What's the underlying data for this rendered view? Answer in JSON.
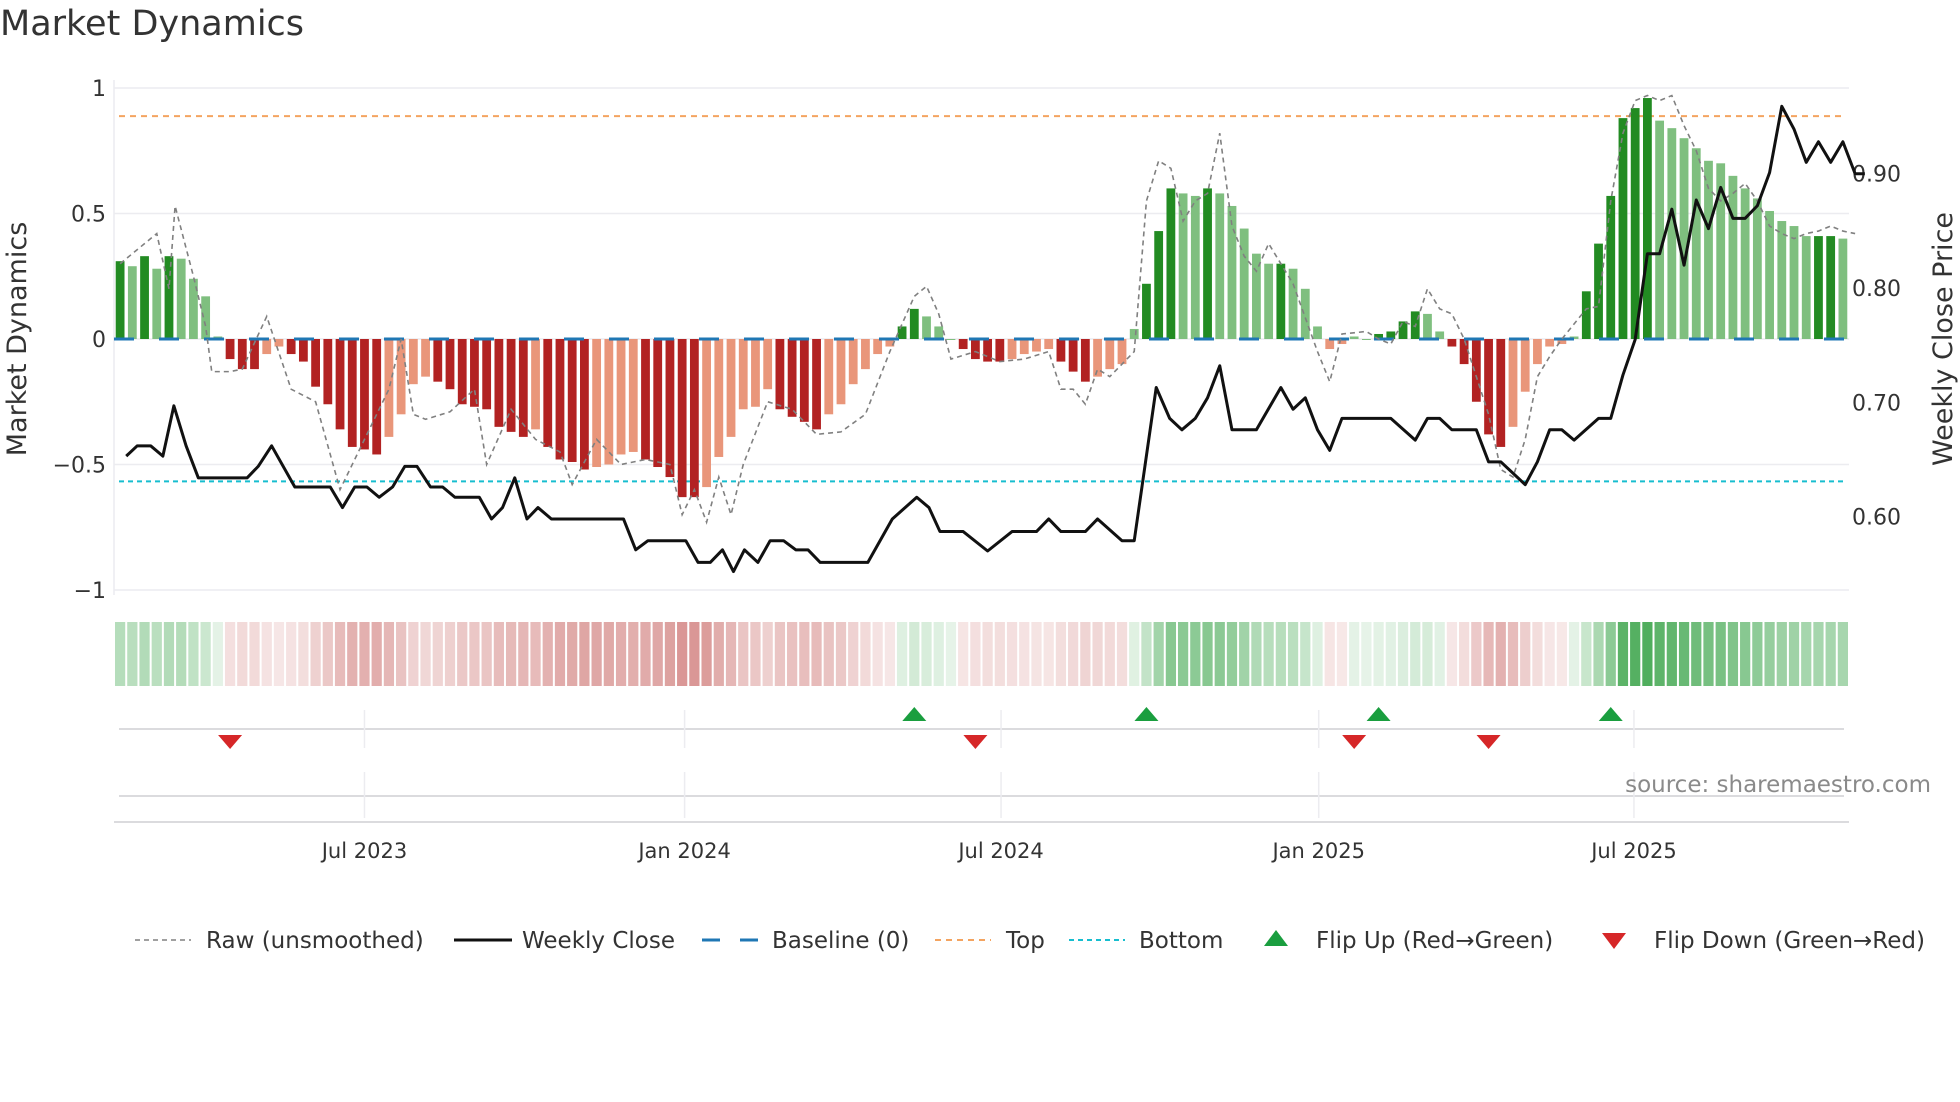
{
  "chart_data": {
    "type": "bar",
    "title": "Market Dynamics",
    "ylabel": "Market Dynamics",
    "y2label": "Weekly Close Price",
    "ylim": [
      -1,
      1
    ],
    "y2lim": [
      0.535,
      0.975
    ],
    "yticks": [
      {
        "v": 1,
        "label": "1"
      },
      {
        "v": 0.5,
        "label": "0.5"
      },
      {
        "v": 0,
        "label": "0"
      },
      {
        "v": -0.5,
        "label": "−0.5"
      },
      {
        "v": -1,
        "label": "−1"
      }
    ],
    "y2ticks": [
      {
        "v": 0.9,
        "label": "0.90"
      },
      {
        "v": 0.8,
        "label": "0.80"
      },
      {
        "v": 0.7,
        "label": "0.70"
      },
      {
        "v": 0.6,
        "label": "0.60"
      }
    ],
    "xticks": [
      {
        "week": 20,
        "label": "Jul 2023"
      },
      {
        "week": 46.2,
        "label": "Jan 2024"
      },
      {
        "week": 72.1,
        "label": "Jul 2024"
      },
      {
        "week": 98.1,
        "label": "Jan 2025"
      },
      {
        "week": 123.9,
        "label": "Jul 2025"
      }
    ],
    "x_unit": "weeks since start (Feb 2023)",
    "top_level": 0.888,
    "bottom_level": -0.567,
    "baseline": 0,
    "bars": [
      0.31,
      0.29,
      0.33,
      0.28,
      0.33,
      0.32,
      0.24,
      0.17,
      0.01,
      -0.08,
      -0.12,
      -0.12,
      -0.06,
      -0.03,
      -0.06,
      -0.09,
      -0.19,
      -0.26,
      -0.36,
      -0.43,
      -0.44,
      -0.46,
      -0.39,
      -0.3,
      -0.18,
      -0.15,
      -0.17,
      -0.2,
      -0.26,
      -0.27,
      -0.28,
      -0.35,
      -0.37,
      -0.39,
      -0.36,
      -0.43,
      -0.48,
      -0.49,
      -0.52,
      -0.51,
      -0.5,
      -0.46,
      -0.45,
      -0.48,
      -0.51,
      -0.55,
      -0.63,
      -0.63,
      -0.59,
      -0.47,
      -0.39,
      -0.28,
      -0.27,
      -0.2,
      -0.28,
      -0.31,
      -0.33,
      -0.36,
      -0.3,
      -0.26,
      -0.18,
      -0.12,
      -0.06,
      -0.03,
      0.05,
      0.12,
      0.09,
      0.05,
      0.0,
      -0.04,
      -0.08,
      -0.09,
      -0.09,
      -0.08,
      -0.06,
      -0.05,
      -0.04,
      -0.09,
      -0.13,
      -0.17,
      -0.15,
      -0.12,
      -0.1,
      0.04,
      0.22,
      0.43,
      0.6,
      0.58,
      0.57,
      0.6,
      0.58,
      0.53,
      0.44,
      0.34,
      0.3,
      0.3,
      0.28,
      0.2,
      0.05,
      -0.04,
      -0.02,
      0.01,
      0.0,
      0.02,
      0.03,
      0.07,
      0.11,
      0.1,
      0.03,
      -0.03,
      -0.1,
      -0.25,
      -0.38,
      -0.43,
      -0.35,
      -0.21,
      -0.1,
      -0.03,
      -0.02,
      0.01,
      0.19,
      0.38,
      0.57,
      0.88,
      0.92,
      0.96,
      0.87,
      0.84,
      0.8,
      0.76,
      0.71,
      0.7,
      0.65,
      0.6,
      0.56,
      0.51,
      0.47,
      0.45,
      0.41,
      0.41,
      0.41,
      0.4
    ],
    "raw": [
      [
        0,
        0.3
      ],
      [
        3,
        0.42
      ],
      [
        4,
        0.2
      ],
      [
        4.5,
        0.53
      ],
      [
        6,
        0.25
      ],
      [
        7,
        0.05
      ],
      [
        7.5,
        -0.13
      ],
      [
        9,
        -0.13
      ],
      [
        10,
        -0.12
      ],
      [
        12,
        0.09
      ],
      [
        14,
        -0.2
      ],
      [
        16,
        -0.25
      ],
      [
        18,
        -0.6
      ],
      [
        20,
        -0.4
      ],
      [
        22,
        -0.2
      ],
      [
        23,
        0
      ],
      [
        24,
        -0.3
      ],
      [
        25,
        -0.32
      ],
      [
        27,
        -0.29
      ],
      [
        29,
        -0.2
      ],
      [
        30,
        -0.5
      ],
      [
        32,
        -0.28
      ],
      [
        34,
        -0.4
      ],
      [
        36,
        -0.45
      ],
      [
        37,
        -0.58
      ],
      [
        39,
        -0.4
      ],
      [
        41,
        -0.5
      ],
      [
        43,
        -0.48
      ],
      [
        45,
        -0.5
      ],
      [
        46,
        -0.7
      ],
      [
        47,
        -0.6
      ],
      [
        48,
        -0.73
      ],
      [
        49,
        -0.55
      ],
      [
        50,
        -0.7
      ],
      [
        51,
        -0.5
      ],
      [
        53,
        -0.25
      ],
      [
        55,
        -0.28
      ],
      [
        57,
        -0.38
      ],
      [
        59,
        -0.37
      ],
      [
        61,
        -0.3
      ],
      [
        63,
        -0.05
      ],
      [
        65,
        0.17
      ],
      [
        66,
        0.21
      ],
      [
        67,
        0.1
      ],
      [
        68,
        -0.08
      ],
      [
        70,
        -0.05
      ],
      [
        72,
        -0.09
      ],
      [
        74,
        -0.08
      ],
      [
        76,
        -0.05
      ],
      [
        77,
        -0.2
      ],
      [
        78,
        -0.2
      ],
      [
        79,
        -0.26
      ],
      [
        80,
        -0.12
      ],
      [
        81,
        -0.15
      ],
      [
        83,
        -0.05
      ],
      [
        84,
        0.55
      ],
      [
        85,
        0.71
      ],
      [
        86,
        0.68
      ],
      [
        87,
        0.47
      ],
      [
        88,
        0.55
      ],
      [
        89,
        0.58
      ],
      [
        90,
        0.82
      ],
      [
        91,
        0.45
      ],
      [
        92,
        0.33
      ],
      [
        93,
        0.27
      ],
      [
        94,
        0.38
      ],
      [
        95,
        0.3
      ],
      [
        96,
        0.22
      ],
      [
        98,
        -0.05
      ],
      [
        99,
        -0.17
      ],
      [
        100,
        0.02
      ],
      [
        102,
        0.03
      ],
      [
        103,
        0.0
      ],
      [
        104,
        -0.02
      ],
      [
        105,
        0.07
      ],
      [
        106,
        0.05
      ],
      [
        107,
        0.2
      ],
      [
        108,
        0.12
      ],
      [
        109,
        0.1
      ],
      [
        110,
        0.0
      ],
      [
        111,
        -0.15
      ],
      [
        112,
        -0.3
      ],
      [
        113,
        -0.52
      ],
      [
        114,
        -0.55
      ],
      [
        115,
        -0.4
      ],
      [
        116,
        -0.15
      ],
      [
        117,
        -0.07
      ],
      [
        118,
        0.0
      ],
      [
        120,
        0.12
      ],
      [
        121,
        0.13
      ],
      [
        122,
        0.55
      ],
      [
        123,
        0.82
      ],
      [
        124,
        0.95
      ],
      [
        125,
        0.97
      ],
      [
        126,
        0.95
      ],
      [
        127,
        0.97
      ],
      [
        128,
        0.85
      ],
      [
        129,
        0.75
      ],
      [
        130,
        0.6
      ],
      [
        131,
        0.55
      ],
      [
        132,
        0.58
      ],
      [
        133,
        0.62
      ],
      [
        134,
        0.55
      ],
      [
        135,
        0.45
      ],
      [
        136,
        0.42
      ],
      [
        137,
        0.4
      ],
      [
        138,
        0.42
      ],
      [
        139,
        0.43
      ],
      [
        140,
        0.45
      ],
      [
        141,
        0.43
      ],
      [
        142,
        0.42
      ]
    ],
    "price": [
      [
        0.5,
        0.653
      ],
      [
        1.4,
        0.662
      ],
      [
        2.5,
        0.662
      ],
      [
        3.5,
        0.653
      ],
      [
        4.4,
        0.697
      ],
      [
        5.4,
        0.662
      ],
      [
        6.4,
        0.634
      ],
      [
        10.4,
        0.634
      ],
      [
        11.3,
        0.644
      ],
      [
        12.4,
        0.662
      ],
      [
        14.3,
        0.626
      ],
      [
        17.2,
        0.626
      ],
      [
        18.2,
        0.608
      ],
      [
        19.2,
        0.626
      ],
      [
        20.2,
        0.626
      ],
      [
        21.2,
        0.617
      ],
      [
        22.3,
        0.626
      ],
      [
        23.3,
        0.644
      ],
      [
        24.3,
        0.644
      ],
      [
        25.4,
        0.626
      ],
      [
        26.4,
        0.626
      ],
      [
        27.4,
        0.617
      ],
      [
        29.4,
        0.617
      ],
      [
        30.4,
        0.598
      ],
      [
        31.3,
        0.608
      ],
      [
        32.3,
        0.634
      ],
      [
        33.3,
        0.598
      ],
      [
        34.2,
        0.608
      ],
      [
        35.3,
        0.598
      ],
      [
        41.2,
        0.598
      ],
      [
        42.2,
        0.571
      ],
      [
        43.2,
        0.579
      ],
      [
        46.3,
        0.579
      ],
      [
        47.3,
        0.56
      ],
      [
        48.3,
        0.56
      ],
      [
        49.3,
        0.571
      ],
      [
        50.2,
        0.552
      ],
      [
        51.1,
        0.571
      ],
      [
        52.2,
        0.56
      ],
      [
        53.2,
        0.579
      ],
      [
        54.3,
        0.579
      ],
      [
        55.3,
        0.571
      ],
      [
        56.3,
        0.571
      ],
      [
        57.3,
        0.56
      ],
      [
        61.2,
        0.56
      ],
      [
        63.2,
        0.598
      ],
      [
        65.2,
        0.617
      ],
      [
        66.2,
        0.608
      ],
      [
        67.1,
        0.587
      ],
      [
        69,
        0.587
      ],
      [
        71,
        0.57
      ],
      [
        73,
        0.587
      ],
      [
        75,
        0.587
      ],
      [
        76,
        0.598
      ],
      [
        77,
        0.587
      ],
      [
        79,
        0.587
      ],
      [
        80,
        0.598
      ],
      [
        82,
        0.579
      ],
      [
        83,
        0.579
      ],
      [
        84.8,
        0.713
      ],
      [
        85.9,
        0.686
      ],
      [
        86.9,
        0.676
      ],
      [
        88,
        0.686
      ],
      [
        89,
        0.704
      ],
      [
        90,
        0.732
      ],
      [
        91,
        0.676
      ],
      [
        93,
        0.676
      ],
      [
        95,
        0.713
      ],
      [
        96,
        0.694
      ],
      [
        97,
        0.704
      ],
      [
        98,
        0.676
      ],
      [
        99,
        0.658
      ],
      [
        100,
        0.686
      ],
      [
        104,
        0.686
      ],
      [
        106,
        0.667
      ],
      [
        107,
        0.686
      ],
      [
        108,
        0.686
      ],
      [
        109,
        0.676
      ],
      [
        111,
        0.676
      ],
      [
        112,
        0.648
      ],
      [
        113,
        0.648
      ],
      [
        115,
        0.628
      ],
      [
        116,
        0.648
      ],
      [
        117,
        0.676
      ],
      [
        118,
        0.676
      ],
      [
        119,
        0.667
      ],
      [
        121,
        0.686
      ],
      [
        122,
        0.686
      ],
      [
        123,
        0.724
      ],
      [
        124,
        0.755
      ],
      [
        125,
        0.83
      ],
      [
        126,
        0.83
      ],
      [
        127,
        0.869
      ],
      [
        128,
        0.82
      ],
      [
        129,
        0.877
      ],
      [
        130,
        0.852
      ],
      [
        131,
        0.888
      ],
      [
        132,
        0.861
      ],
      [
        133,
        0.861
      ],
      [
        134,
        0.872
      ],
      [
        135,
        0.901
      ],
      [
        136,
        0.959
      ],
      [
        137,
        0.939
      ],
      [
        138,
        0.91
      ],
      [
        139,
        0.928
      ],
      [
        140,
        0.91
      ],
      [
        141,
        0.928
      ],
      [
        142,
        0.9
      ],
      [
        142.8,
        0.9
      ]
    ],
    "flip_up_weeks": [
      65,
      84,
      103,
      122
    ],
    "flip_down_weeks": [
      9,
      70,
      101,
      112
    ],
    "legend_placement": "bottom",
    "legend": [
      {
        "key": "raw",
        "label": "Raw (unsmoothed)"
      },
      {
        "key": "close",
        "label": "Weekly Close"
      },
      {
        "key": "baseline",
        "label": "Baseline (0)"
      },
      {
        "key": "top",
        "label": "Top"
      },
      {
        "key": "bottom",
        "label": "Bottom"
      },
      {
        "key": "up",
        "label": "Flip Up (Red→Green)"
      },
      {
        "key": "down",
        "label": "Flip Down (Green→Red)"
      }
    ],
    "source": "source: sharemaestro.com",
    "colors": {
      "strong_up": "#228b22",
      "weak_up": "#7fbf7f",
      "strong_down": "#b22222",
      "weak_down": "#e9967a",
      "baseline": "#1f77b4",
      "top": "#f4a460",
      "bottom": "#17becf",
      "flip_up": "#1a9e3f",
      "flip_down": "#d62728",
      "raw": "#808080",
      "close": "#111111"
    }
  }
}
